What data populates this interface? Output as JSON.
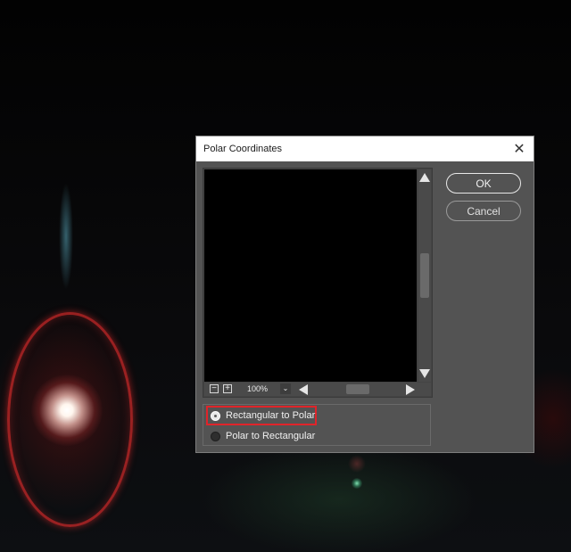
{
  "dialog": {
    "title": "Polar Coordinates",
    "close_glyph": "✕",
    "ok_label": "OK",
    "cancel_label": "Cancel"
  },
  "preview": {
    "zoom_out_glyph": "−",
    "zoom_in_glyph": "+",
    "zoom_level": "100%",
    "zoom_dropdown_glyph": "⌄"
  },
  "options": {
    "items": [
      {
        "label": "Rectangular to Polar",
        "checked": true
      },
      {
        "label": "Polar to Rectangular",
        "checked": false
      }
    ]
  },
  "colors": {
    "dialog_bg": "#535353",
    "titlebar_bg": "#ffffff",
    "highlight": "#e0242a"
  }
}
